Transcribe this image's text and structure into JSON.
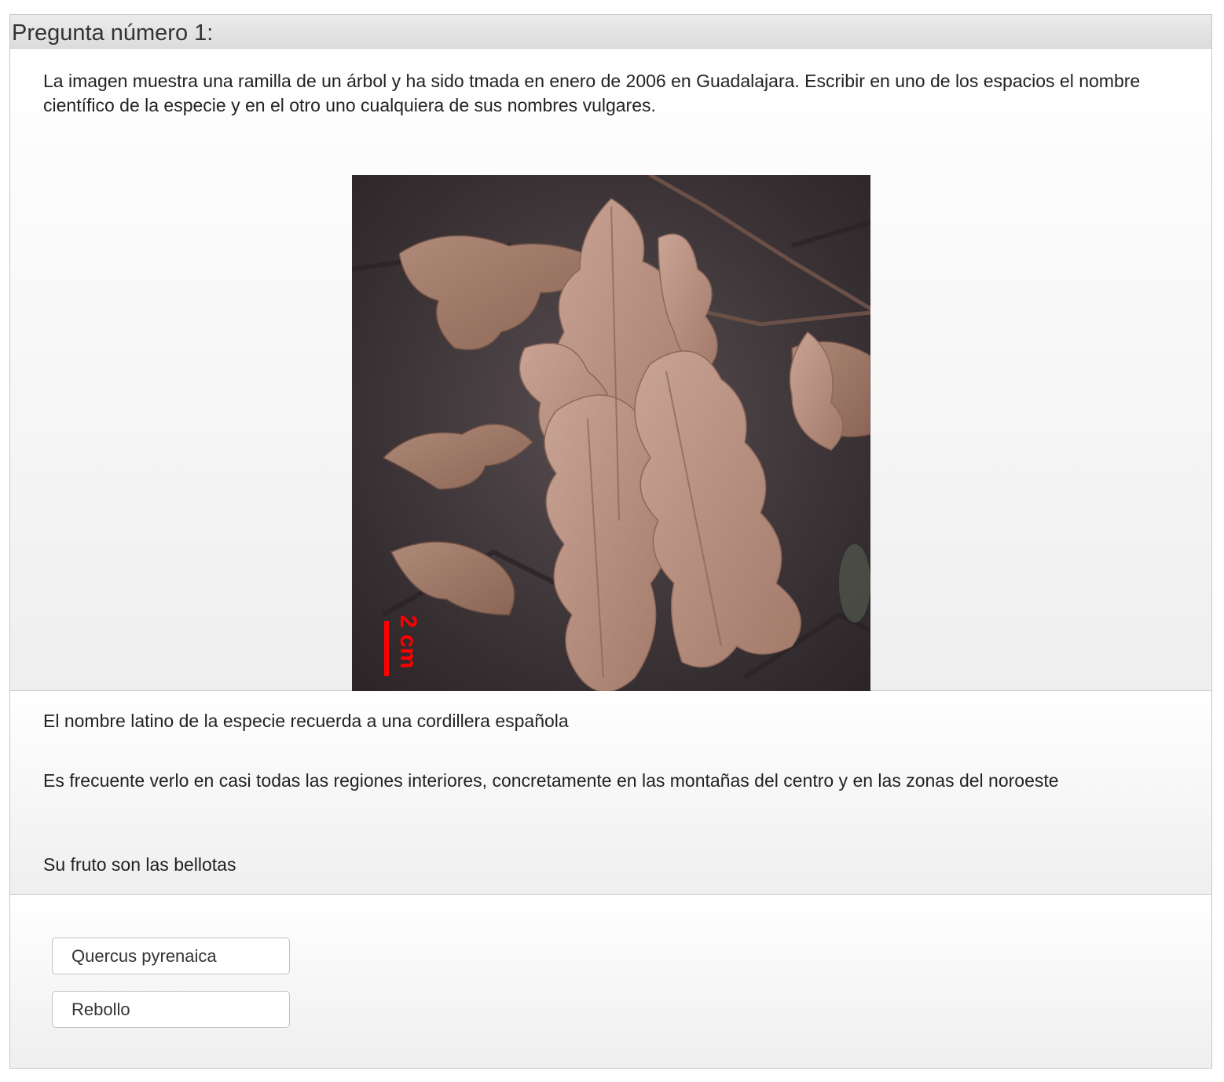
{
  "question": {
    "title": "Pregunta número 1:",
    "text": "La imagen muestra una ramilla de un árbol y ha sido tmada en enero de 2006 en Guadalajara. Escribir en uno de los espacios el nombre científico de la especie y en el otro uno cualquiera de sus nombres vulgares.",
    "image": {
      "scale_label": "2 cm",
      "scale_color": "#ff0000"
    }
  },
  "hints": [
    "El nombre latino de la especie recuerda a una cordillera española",
    "Es frecuente verlo en casi todas las regiones interiores, concretamente en las montañas del centro y en las zonas del noroeste",
    "Su fruto son las bellotas"
  ],
  "answers": {
    "scientific_name": "Quercus pyrenaica",
    "common_name": "Rebollo"
  }
}
